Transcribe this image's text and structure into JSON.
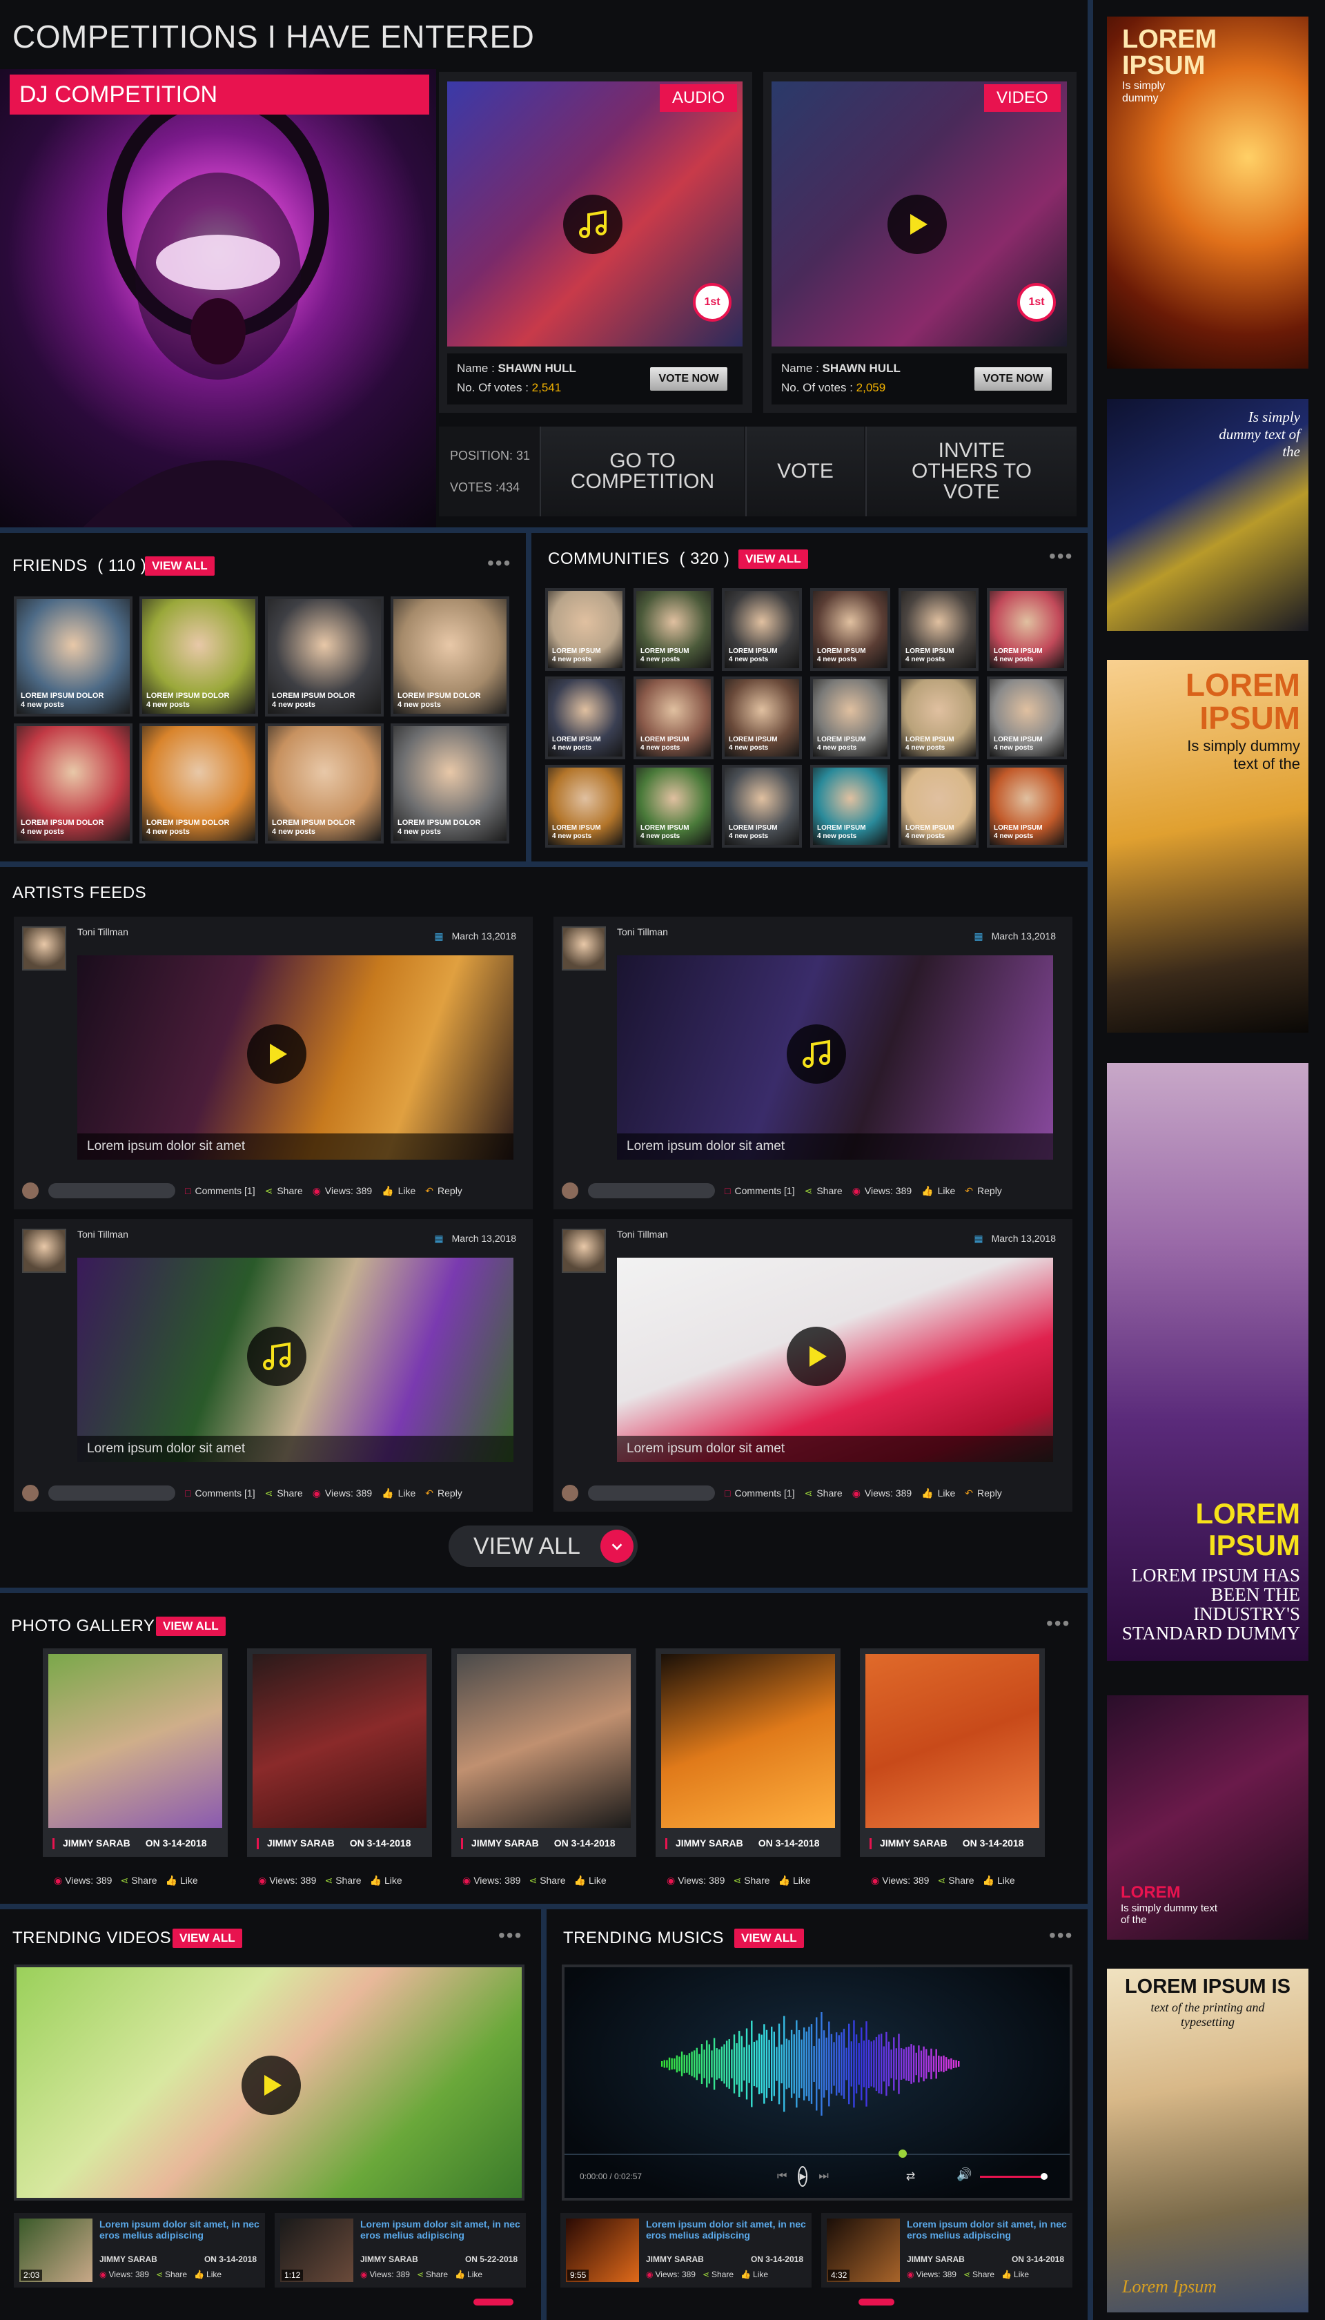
{
  "competitions": {
    "title": "COMPETITIONS I HAVE ENTERED",
    "category": "DJ COMPETITION",
    "entries": [
      {
        "badge": "AUDIO",
        "name_label": "Name :",
        "name": "SHAWN HULL",
        "votes_label": "No. Of votes :",
        "votes": "2,541",
        "vote_button": "VOTE NOW",
        "award": "1st"
      },
      {
        "badge": "VIDEO",
        "name_label": "Name :",
        "name": "SHAWN HULL",
        "votes_label": "No. Of votes :",
        "votes": "2,059",
        "vote_button": "VOTE NOW",
        "award": "1st"
      }
    ],
    "position": "POSITION: 31",
    "votes": "VOTES :434",
    "go_button": "GO TO COMPETITION",
    "vote_button": "VOTE",
    "invite_button": "INVITE OTHERS TO VOTE"
  },
  "friends": {
    "title": "FRIENDS",
    "count": "( 110 )",
    "view_all": "VIEW ALL",
    "items": [
      {
        "name": "LOREM IPSUM DOLOR",
        "posts": "4 new posts",
        "color": "#4d6a86"
      },
      {
        "name": "LOREM IPSUM DOLOR",
        "posts": "4 new posts",
        "color": "#9aa83a"
      },
      {
        "name": "LOREM IPSUM DOLOR",
        "posts": "4 new posts",
        "color": "#3e3f44"
      },
      {
        "name": "LOREM IPSUM DOLOR",
        "posts": "4 new posts",
        "color": "#a58a6a"
      },
      {
        "name": "LOREM IPSUM DOLOR",
        "posts": "4 new posts",
        "color": "#c23a45"
      },
      {
        "name": "LOREM IPSUM DOLOR",
        "posts": "4 new posts",
        "color": "#d9842c"
      },
      {
        "name": "LOREM IPSUM DOLOR",
        "posts": "4 new posts",
        "color": "#c7915f"
      },
      {
        "name": "LOREM IPSUM DOLOR",
        "posts": "4 new posts",
        "color": "#6d6e70"
      }
    ]
  },
  "communities": {
    "title": "COMMUNITIES",
    "count": "( 320 )",
    "view_all": "VIEW ALL",
    "items": [
      {
        "name": "LOREM IPSUM",
        "posts": "4 new posts",
        "color": "#b8a48a"
      },
      {
        "name": "LOREM IPSUM",
        "posts": "4 new posts",
        "color": "#4b5a3a"
      },
      {
        "name": "LOREM IPSUM",
        "posts": "4 new posts",
        "color": "#3c3c3e"
      },
      {
        "name": "LOREM IPSUM",
        "posts": "4 new posts",
        "color": "#5a3d34"
      },
      {
        "name": "LOREM IPSUM",
        "posts": "4 new posts",
        "color": "#4a4440"
      },
      {
        "name": "LOREM IPSUM",
        "posts": "4 new posts",
        "color": "#c24a5a"
      },
      {
        "name": "LOREM IPSUM",
        "posts": "4 new posts",
        "color": "#3a3f52"
      },
      {
        "name": "LOREM IPSUM",
        "posts": "4 new posts",
        "color": "#8a5a4a"
      },
      {
        "name": "LOREM IPSUM",
        "posts": "4 new posts",
        "color": "#6a4a3a"
      },
      {
        "name": "LOREM IPSUM",
        "posts": "4 new posts",
        "color": "#7a7a78"
      },
      {
        "name": "LOREM IPSUM",
        "posts": "4 new posts",
        "color": "#b9a27a"
      },
      {
        "name": "LOREM IPSUM",
        "posts": "4 new posts",
        "color": "#8a8a8a"
      },
      {
        "name": "LOREM IPSUM",
        "posts": "4 new posts",
        "color": "#b3752a"
      },
      {
        "name": "LOREM IPSUM",
        "posts": "4 new posts",
        "color": "#4a7a3a"
      },
      {
        "name": "LOREM IPSUM",
        "posts": "4 new posts",
        "color": "#4a4f55"
      },
      {
        "name": "LOREM IPSUM",
        "posts": "4 new posts",
        "color": "#2a8a9a"
      },
      {
        "name": "LOREM IPSUM",
        "posts": "4 new posts",
        "color": "#d9b88a"
      },
      {
        "name": "LOREM IPSUM",
        "posts": "4 new posts",
        "color": "#c25a2a"
      }
    ]
  },
  "feeds": {
    "title": "ARTISTS FEEDS",
    "items": [
      {
        "author": "Toni Tillman",
        "date": "March  13,2018",
        "caption": "Lorem ipsum dolor sit amet",
        "comments": "Comments [1]",
        "share": "Share",
        "views": "Views: 389",
        "like": "Like",
        "reply": "Reply",
        "media": "video",
        "bg": "linear-gradient(110deg,#1a0d1c 0%,#4b1d3a 35%,#c77a1e 60%,#e0a040 75%,#2a1a18 100%)"
      },
      {
        "author": "Toni Tillman",
        "date": "March  13,2018",
        "caption": "Lorem ipsum dolor sit amet",
        "comments": "Comments [1]",
        "share": "Share",
        "views": "Views: 389",
        "like": "Like",
        "reply": "Reply",
        "media": "audio",
        "bg": "linear-gradient(110deg,#1a1430 0%,#3a2c6a 40%,#2b1a2a 60%,#8a4aa0 100%)"
      },
      {
        "author": "Toni Tillman",
        "date": "March  13,2018",
        "caption": "Lorem ipsum dolor sit amet",
        "comments": "Comments [1]",
        "share": "Share",
        "views": "Views: 389",
        "like": "Like",
        "reply": "Reply",
        "media": "audio",
        "bg": "linear-gradient(110deg,#3a1a5a 0%,#2a5a2a 35%,#c4b090 55%,#7a3ab0 75%,#3a6a2a 100%)"
      },
      {
        "author": "Toni Tillman",
        "date": "March  13,2018",
        "caption": "Lorem ipsum dolor sit amet",
        "comments": "Comments [1]",
        "share": "Share",
        "views": "Views: 389",
        "like": "Like",
        "reply": "Reply",
        "media": "video",
        "bg": "linear-gradient(160deg,#f2f2f2 0%,#e8e4e6 40%,#e0224e 65%,#b01030 85%,#3a2a2a 100%)"
      }
    ],
    "view_all": "VIEW ALL"
  },
  "gallery": {
    "title": "PHOTO GALLERY",
    "view_all": "VIEW ALL",
    "items": [
      {
        "name": "JIMMY SARAB",
        "date": "ON 3-14-2018",
        "views": "Views: 389",
        "share": "Share",
        "like": "Like",
        "bg": "linear-gradient(160deg,#7aa84a,#cfae8a 50%,#8a5ab0)"
      },
      {
        "name": "JIMMY SARAB",
        "date": "ON 3-14-2018",
        "views": "Views: 389",
        "share": "Share",
        "like": "Like",
        "bg": "linear-gradient(160deg,#2a1a1a,#8a2a2a 50%,#3a1010)"
      },
      {
        "name": "JIMMY SARAB",
        "date": "ON 3-14-2018",
        "views": "Views: 389",
        "share": "Share",
        "like": "Like",
        "bg": "linear-gradient(160deg,#4a4a4a,#c09070 50%,#1a1a1a)"
      },
      {
        "name": "JIMMY SARAB",
        "date": "ON 3-14-2018",
        "views": "Views: 389",
        "share": "Share",
        "like": "Like",
        "bg": "linear-gradient(160deg,#1a1008,#e07a1a 50%,#ffb040)"
      },
      {
        "name": "JIMMY SARAB",
        "date": "ON 3-14-2018",
        "views": "Views: 389",
        "share": "Share",
        "like": "Like",
        "bg": "linear-gradient(160deg,#e06a2a,#c84a1a 50%,#f08040)"
      }
    ]
  },
  "trending_videos": {
    "title": "TRENDING VIDEOS",
    "view_all": "VIEW ALL",
    "items": [
      {
        "title": "Lorem ipsum dolor sit amet, in nec eros melius adipiscing",
        "name": "JIMMY SARAB",
        "date": "ON 3-14-2018",
        "duration": "2:03",
        "views": "Views: 389",
        "share": "Share",
        "like": "Like"
      },
      {
        "title": "Lorem ipsum dolor sit amet, in nec eros melius adipiscing",
        "name": "JIMMY SARAB",
        "date": "ON 5-22-2018",
        "duration": "1:12",
        "views": "Views: 389",
        "share": "Share",
        "like": "Like"
      }
    ]
  },
  "trending_musics": {
    "title": "TRENDING MUSICS",
    "view_all": "VIEW ALL",
    "time": "0:00:00 / 0:02:57",
    "items": [
      {
        "title": "Lorem ipsum dolor sit amet, in nec eros melius adipiscing",
        "name": "JIMMY SARAB",
        "date": "ON 3-14-2018",
        "duration": "9:55",
        "views": "Views: 389",
        "share": "Share",
        "like": "Like"
      },
      {
        "title": "Lorem ipsum dolor sit amet, in nec eros melius adipiscing",
        "name": "JIMMY SARAB",
        "date": "ON 3-14-2018",
        "duration": "4:32",
        "views": "Views: 389",
        "share": "Share",
        "like": "Like"
      }
    ]
  },
  "ads": [
    {
      "headline": "LOREM IPSUM",
      "sub": "Is simply dummy"
    },
    {
      "headline": "",
      "sub": "Is simply dummy text of the"
    },
    {
      "headline": "LOREM IPSUM",
      "sub": "Is simply dummy text of the"
    },
    {
      "headline": "LOREM IPSUM",
      "sub": "LOREM IPSUM HAS BEEN THE INDUSTRY'S STANDARD DUMMY"
    },
    {
      "headline": "LOREM",
      "sub": "Is simply dummy text of the"
    },
    {
      "headline": "LOREM IPSUM IS",
      "sub": "text of the printing and typesetting",
      "sign": "Lorem Ipsum"
    }
  ],
  "colors": {
    "accent": "#e8134f",
    "vote_yellow": "#f5b400",
    "border_blue": "#1c2f4a",
    "link_blue": "#5aa8e8"
  }
}
